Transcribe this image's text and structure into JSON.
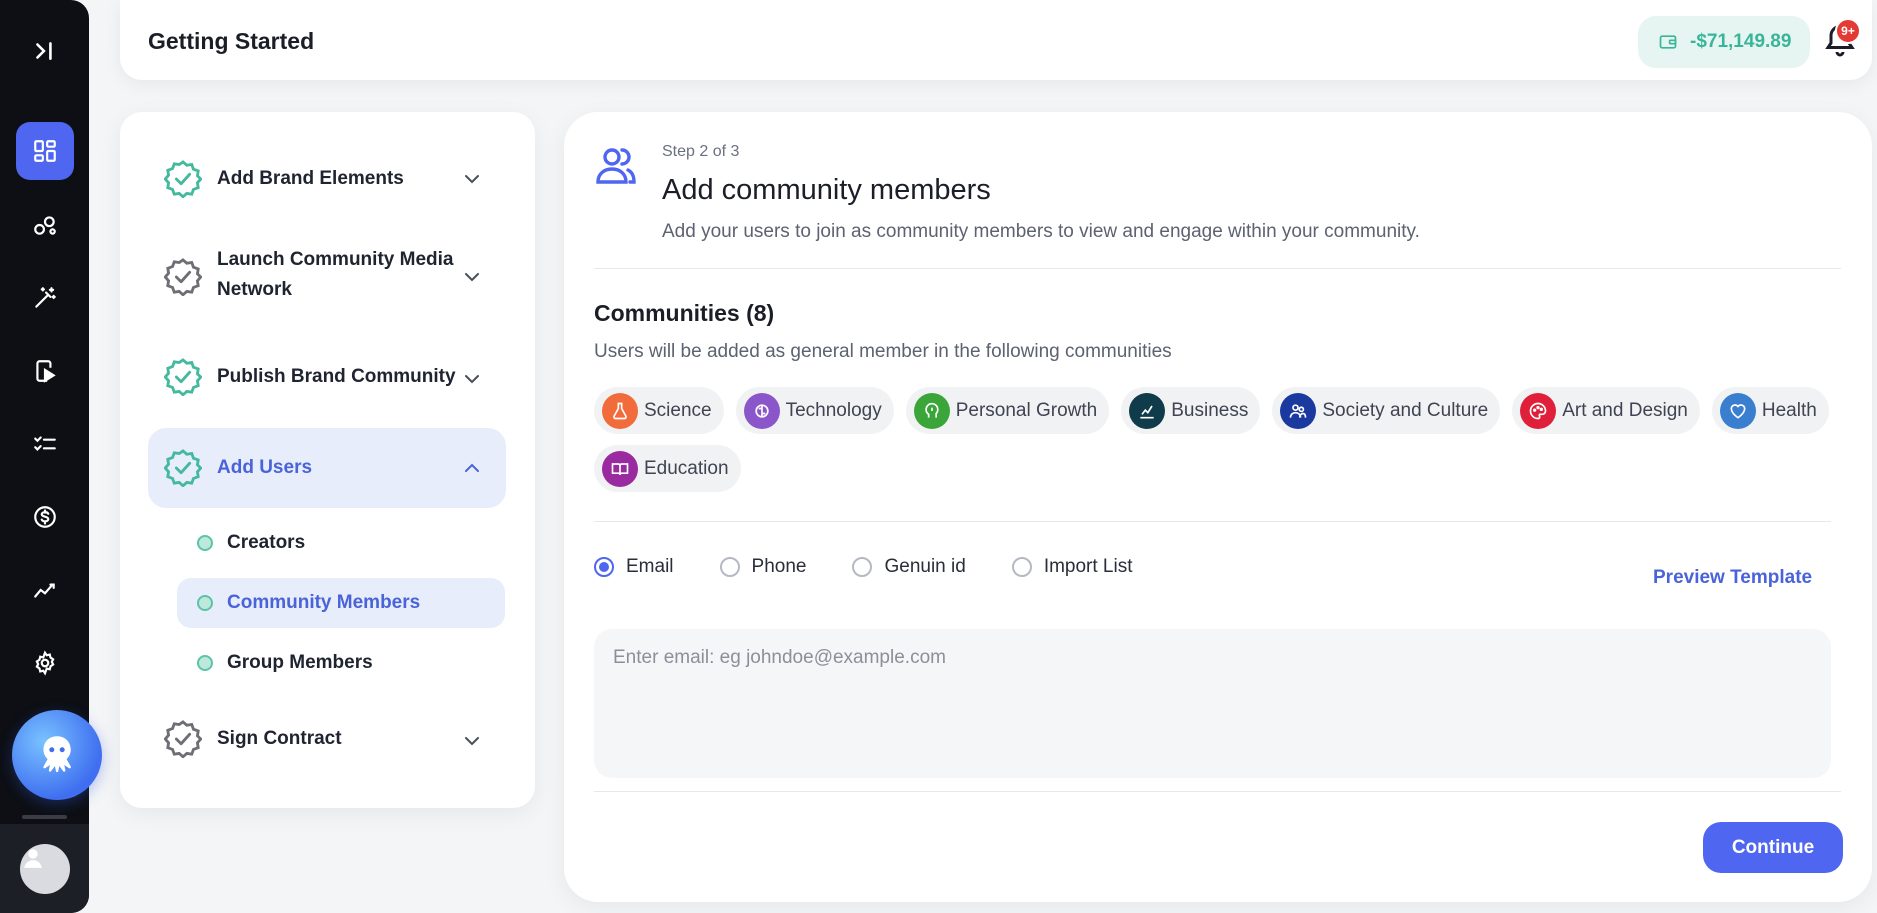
{
  "header": {
    "title": "Getting Started",
    "wallet_amount": "-$71,149.89",
    "notification_badge": "9+"
  },
  "rail": {
    "items": [
      "collapse-icon",
      "dashboard-icon",
      "bubbles-icon",
      "magic-wand-icon",
      "mobile-play-icon",
      "checklist-icon",
      "dollar-icon",
      "analytics-icon",
      "settings-icon"
    ],
    "active": "dashboard-icon"
  },
  "steps": {
    "items": [
      {
        "label": "Add Brand Elements",
        "status": "done"
      },
      {
        "label": "Launch Community Media Network",
        "status": "pending"
      },
      {
        "label": "Publish Brand Community",
        "status": "done"
      },
      {
        "label": "Add Users",
        "status": "done",
        "expanded": true
      },
      {
        "label": "Sign Contract",
        "status": "pending"
      }
    ],
    "sub_items": [
      {
        "label": "Creators"
      },
      {
        "label": "Community Members",
        "active": true
      },
      {
        "label": "Group Members"
      }
    ]
  },
  "main": {
    "step_count": "Step 2 of 3",
    "title": "Add community members",
    "description": "Add your users to join as community members to view and engage within your community.",
    "communities_title": "Communities (8)",
    "communities_subtitle": "Users will be added as general member in the following communities",
    "communities": [
      {
        "label": "Science",
        "color": "#f26b3a",
        "icon": "flask-icon"
      },
      {
        "label": "Technology",
        "color": "#8a56c9",
        "icon": "brain-chip-icon"
      },
      {
        "label": "Personal Growth",
        "color": "#3aa63a",
        "icon": "head-icon"
      },
      {
        "label": "Business",
        "color": "#0f3b4a",
        "icon": "chart-icon"
      },
      {
        "label": "Society and Culture",
        "color": "#1b3aa0",
        "icon": "people-icon"
      },
      {
        "label": "Art and Design",
        "color": "#e0203a",
        "icon": "palette-icon"
      },
      {
        "label": "Health",
        "color": "#3a7fcf",
        "icon": "heart-icon"
      },
      {
        "label": "Education",
        "color": "#9a2aa0",
        "icon": "book-icon"
      }
    ],
    "input_modes": [
      {
        "label": "Email",
        "selected": true
      },
      {
        "label": "Phone",
        "selected": false
      },
      {
        "label": "Genuin id",
        "selected": false
      },
      {
        "label": "Import List",
        "selected": false
      }
    ],
    "preview_link": "Preview Template",
    "email_placeholder": "Enter email: eg johndoe@example.com",
    "email_value": "",
    "continue_label": "Continue"
  }
}
